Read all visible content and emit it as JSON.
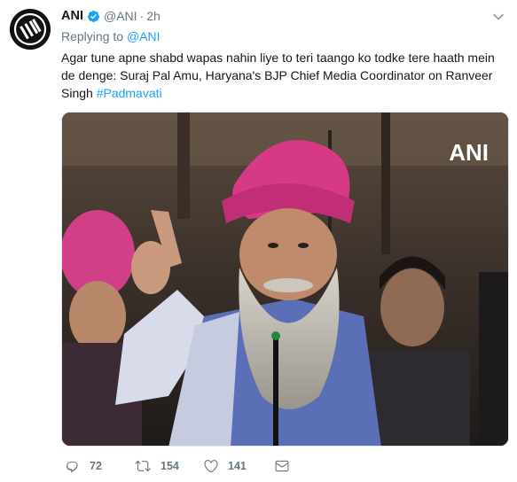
{
  "author": {
    "name": "ANI",
    "handle": "@ANI",
    "time": "2h",
    "separator": "·",
    "avatar_label": "ANI"
  },
  "reply": {
    "prefix": "Replying to",
    "mention": "@ANI"
  },
  "tweet": {
    "text": "Agar tune apne shabd wapas nahin liye to teri taango ko todke tere haath mein de denge: Suraj Pal Amu, Haryana's BJP Chief Media Coordinator on Ranveer Singh ",
    "hashtag": "#Padmavati"
  },
  "media": {
    "watermark": "ANI"
  },
  "actions": {
    "reply_count": "72",
    "retweet_count": "154",
    "like_count": "141"
  },
  "colors": {
    "link": "#1da1f2",
    "muted": "#657786",
    "text": "#14171a",
    "turban": "#d63a86"
  },
  "icons": {
    "verified": "verified-badge-icon",
    "caret": "chevron-down-icon",
    "reply": "reply-icon",
    "retweet": "retweet-icon",
    "like": "heart-icon",
    "dm": "envelope-icon"
  }
}
